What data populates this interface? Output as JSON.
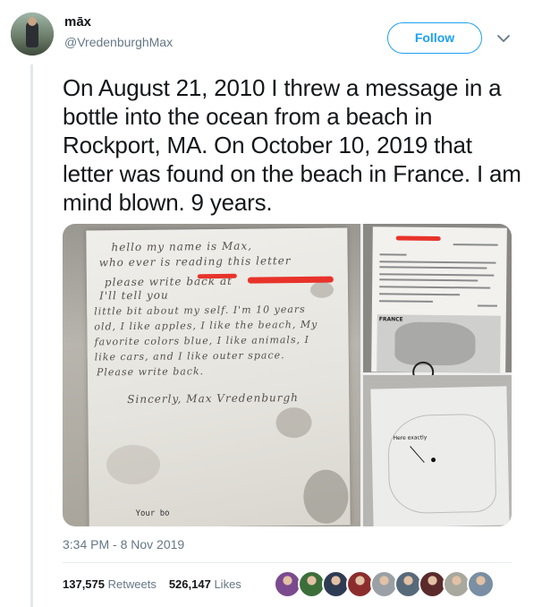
{
  "user": {
    "display_name": "māx",
    "handle": "@VredenburghMax"
  },
  "actions": {
    "follow_label": "Follow",
    "more_icon": "chevron-down-icon"
  },
  "tweet": {
    "text": "On August 21, 2010 I threw a message in a bottle into the ocean from a beach in Rockport, MA. On October 10, 2019 that letter was found on the beach in France. I am mind blown. 9 years.",
    "timestamp": "3:34 PM - 8 Nov 2019"
  },
  "media": {
    "letter_lines": [
      "hello  my   name   is         Max,",
      "who ever is  reading  this  letter",
      "please  write  back at",
      "                  I'll  tell  you",
      "little  bit  about  my self. I'm 10  years",
      "old, I like apples, I like the beach, My",
      "favorite colors blue, I like animals, I",
      "like cars, and  I  like outer space.",
      "Please  write  back.",
      "Sincerly,  Max  Vredenburgh"
    ],
    "letter_footer": "Your bo",
    "doc_heading": "FRANCE",
    "map_label": "Here exactly"
  },
  "stats": {
    "retweets_count": "137,575",
    "retweets_label": "Retweets",
    "likes_count": "526,147",
    "likes_label": "Likes"
  },
  "likers_colors": [
    "#7b4a8f",
    "#3c6e3a",
    "#2f3b52",
    "#8c2d2d",
    "#9aa0a6",
    "#566a7a",
    "#5b2a2a",
    "#a8a89e",
    "#7a8fa3"
  ],
  "colors": {
    "accent": "#1da1f2",
    "secondary_text": "#657786",
    "redaction": "#e8332a"
  }
}
